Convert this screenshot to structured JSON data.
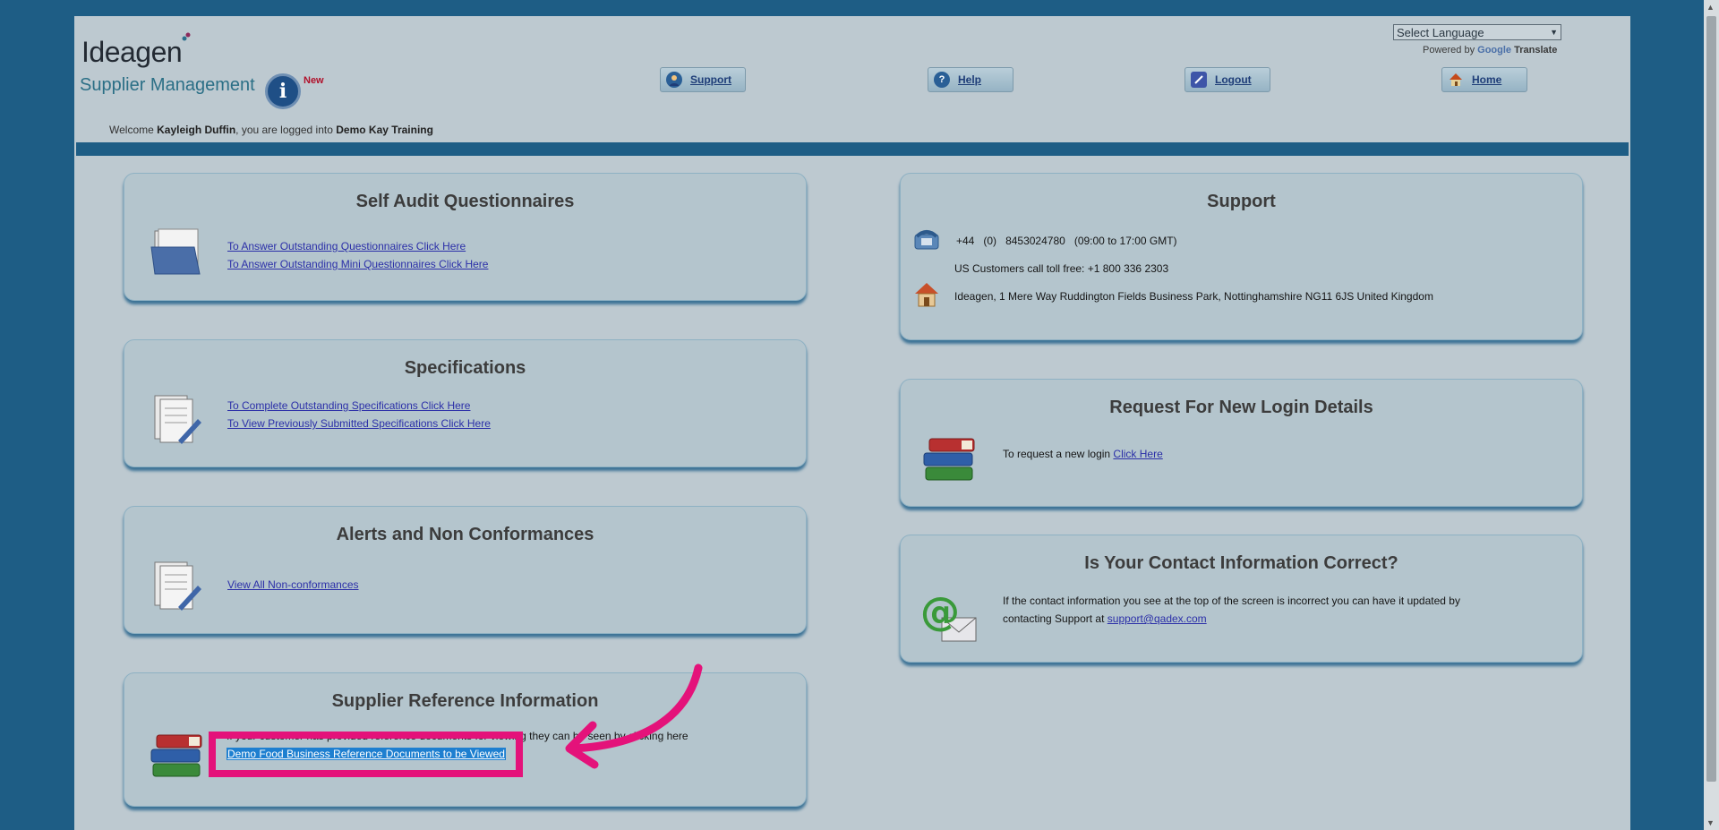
{
  "header": {
    "logo_name": "Ideagen",
    "logo_sub": "Supplier Management",
    "info_icon_glyph": "i",
    "new_badge": "New",
    "nav": [
      {
        "label": "Support",
        "icon": "support-person-icon"
      },
      {
        "label": "Help",
        "icon": "help-question-icon"
      },
      {
        "label": "Logout",
        "icon": "logout-icon"
      },
      {
        "label": "Home",
        "icon": "home-icon"
      }
    ],
    "language_select": "Select Language",
    "powered_by": "Powered by",
    "google": "Google",
    "translate": "Translate",
    "welcome_prefix": "Welcome",
    "user_name": "Kayleigh Duffin",
    "welcome_middle": ", you are logged into",
    "company": "Demo Kay Training"
  },
  "self_audit": {
    "title": "Self Audit Questionnaires",
    "link1": "To Answer Outstanding Questionnaires Click Here",
    "link2": "To Answer Outstanding Mini Questionnaires Click Here"
  },
  "specifications": {
    "title": "Specifications",
    "link1": "To Complete Outstanding Specifications Click Here",
    "link2": "To View Previously Submitted Specifications Click Here"
  },
  "alerts": {
    "title": "Alerts and Non Conformances",
    "link1": "View All Non-conformances"
  },
  "supplier_ref": {
    "title": "Supplier Reference Information",
    "text": "If your customer has provided reference documents for viewing they can be seen by clicking here",
    "link": "Demo Food Business Reference Documents to be Viewed"
  },
  "support": {
    "title": "Support",
    "phone_parts": [
      "+44",
      "(0)",
      "8453024780",
      "(09:00 to 17:00 GMT)"
    ],
    "us_customers": "US Customers call toll free: +1 800 336 2303",
    "address": "Ideagen, 1 Mere Way Ruddington Fields Business Park, Nottinghamshire NG11 6JS United Kingdom"
  },
  "new_login": {
    "title": "Request For New Login Details",
    "text": "To request a new login",
    "link": "Click Here"
  },
  "contact": {
    "title": "Is Your Contact Information Correct?",
    "line1": "If the contact information you see at the top of the screen is incorrect you can have it updated by",
    "line2_prefix": "contacting Support at",
    "email": "support@qadex.com"
  },
  "colors": {
    "overlay_blue": "#1e5d85",
    "annotation_pink": "#e4127a",
    "link_blue": "#2b2fa8"
  }
}
